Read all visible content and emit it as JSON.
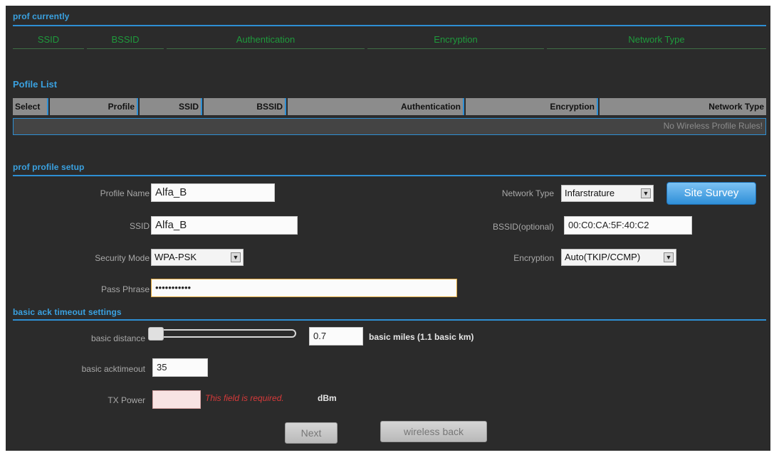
{
  "current": {
    "title": "prof currently",
    "columns": [
      "SSID",
      "BSSID",
      "Authentication",
      "Encryption",
      "Network Type"
    ]
  },
  "profile_list": {
    "title": "Pofile List",
    "columns": [
      "Select",
      "Profile",
      "SSID",
      "BSSID",
      "Authentication",
      "Encryption",
      "Network Type"
    ],
    "empty_text": "No Wireless Profile Rules!"
  },
  "setup": {
    "title": "prof profile setup",
    "profile_name_label": "Profile Name",
    "profile_name_value": "Alfa_B",
    "ssid_label": "SSID",
    "ssid_value": "Alfa_B",
    "security_mode_label": "Security Mode",
    "security_mode_value": "WPA-PSK",
    "pass_phrase_label": "Pass Phrase",
    "pass_phrase_value": "•••••••••••",
    "network_type_label": "Network Type",
    "network_type_value": "Infarstrature",
    "bssid_label": "BSSID(optional)",
    "bssid_value": "00:C0:CA:5F:40:C2",
    "encryption_label": "Encryption",
    "encryption_value": "Auto(TKIP/CCMP)",
    "site_survey_label": "Site Survey"
  },
  "ack": {
    "title": "basic ack timeout settings",
    "distance_label": "basic distance",
    "distance_value": "0.7",
    "distance_unit": "basic miles (1.1 basic km)",
    "distance_level": 0,
    "acktimeout_label": "basic acktimeout",
    "acktimeout_value": "35",
    "tx_power_label": "TX Power",
    "tx_power_value": "",
    "tx_power_error": "This field is required.",
    "tx_power_unit": "dBm"
  },
  "buttons": {
    "next": "Next",
    "wireless_back": "wireless back"
  },
  "colors": {
    "accent_blue": "#2e8fd4",
    "header_green": "#1f9a3c",
    "error_red": "#d83a3a",
    "panel_bg": "#2b2b2b"
  }
}
